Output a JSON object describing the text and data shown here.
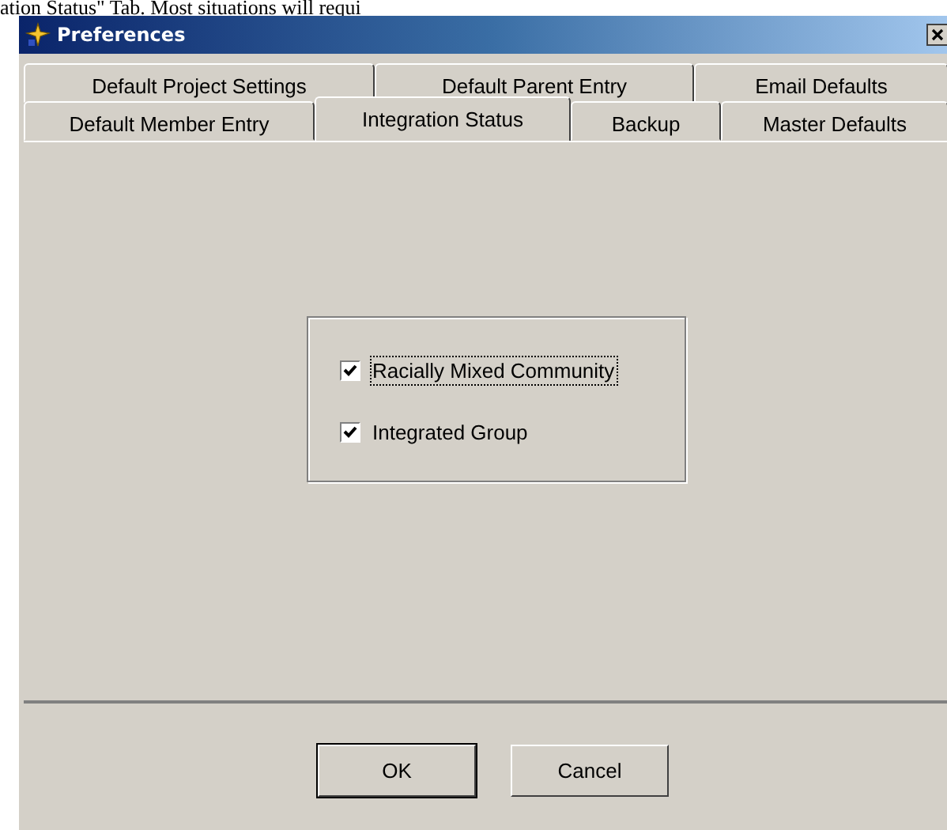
{
  "document_text": "ation Status\" Tab.  Most situations will requi",
  "window": {
    "title": "Preferences"
  },
  "tab_rows": [
    {
      "tabs": [
        {
          "label": "Default Project Settings",
          "selected": false
        },
        {
          "label": "Default Parent Entry",
          "selected": false
        },
        {
          "label": "Email Defaults",
          "selected": false
        }
      ]
    },
    {
      "tabs": [
        {
          "label": "Default Member Entry",
          "selected": false
        },
        {
          "label": "Integration Status",
          "selected": true
        },
        {
          "label": "Backup",
          "selected": false
        },
        {
          "label": "Master Defaults",
          "selected": false
        }
      ]
    }
  ],
  "checkboxes": [
    {
      "label": "Racially Mixed Community",
      "checked": true,
      "focused": true
    },
    {
      "label": "Integrated Group",
      "checked": true,
      "focused": false
    }
  ],
  "buttons": [
    {
      "label": "OK",
      "default": true
    },
    {
      "label": "Cancel",
      "default": false
    }
  ]
}
